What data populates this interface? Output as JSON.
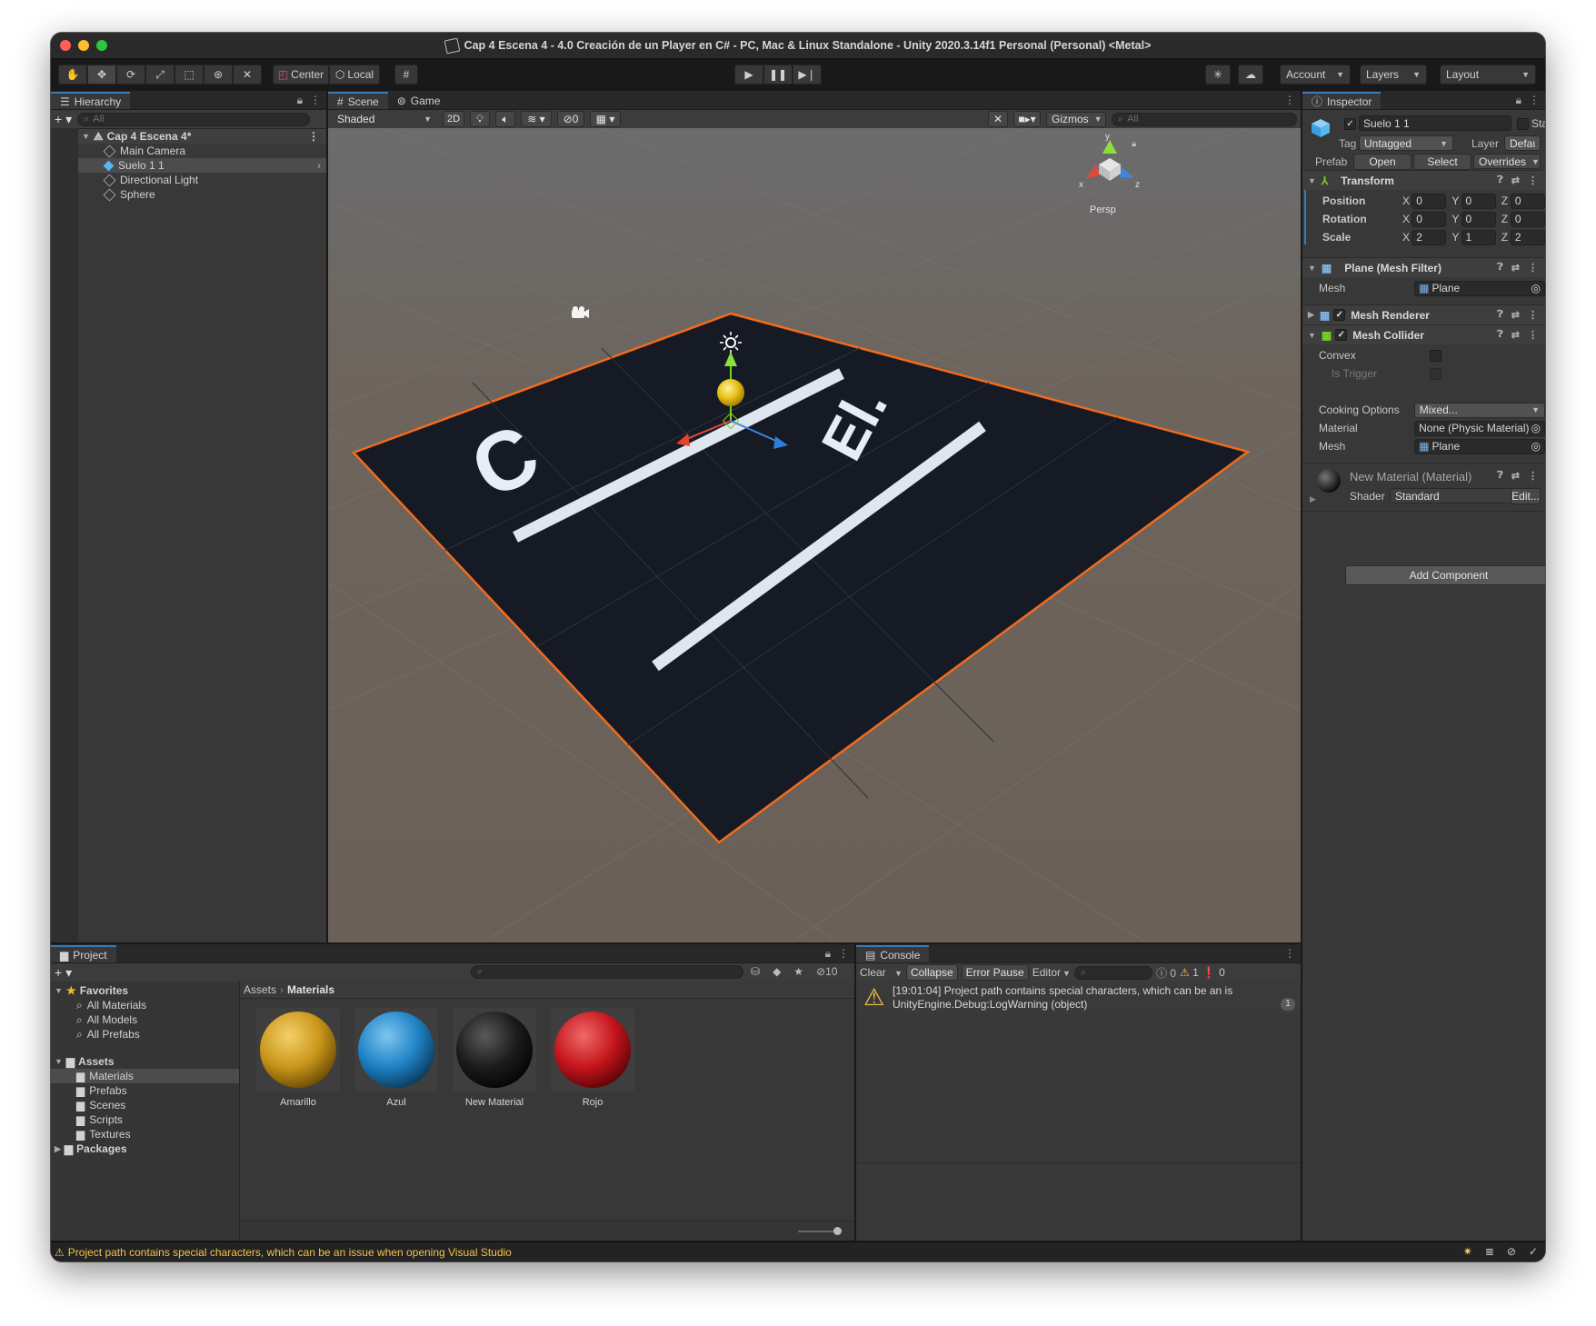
{
  "window": {
    "title": "Cap 4 Escena 4 - 4.0 Creación de un Player en C# - PC, Mac & Linux Standalone - Unity 2020.3.14f1 Personal (Personal) <Metal>"
  },
  "toolbar": {
    "pivot_label": "Center",
    "space_label": "Local",
    "account_label": "Account",
    "layers_label": "Layers",
    "layout_label": "Layout"
  },
  "hierarchy": {
    "tab": "Hierarchy",
    "search_placeholder": "All",
    "scene_name": "Cap 4 Escena 4*",
    "items": [
      {
        "label": "Main Camera"
      },
      {
        "label": "Suelo 1 1"
      },
      {
        "label": "Directional Light"
      },
      {
        "label": "Sphere"
      }
    ]
  },
  "scene": {
    "tabs": [
      "Scene",
      "Game"
    ],
    "shading_mode": "Shaded",
    "mode_2d": "2D",
    "hidden_count": "0",
    "gizmos_label": "Gizmos",
    "search_placeholder": "All",
    "gizmo_axes": {
      "x": "x",
      "y": "y",
      "z": "z"
    },
    "projection": "Persp",
    "floor_text_left": "C",
    "floor_text_right": "El."
  },
  "inspector": {
    "tab": "Inspector",
    "object_name": "Suelo 1 1",
    "static_label": "Static",
    "tag_label": "Tag",
    "tag_value": "Untagged",
    "layer_label": "Layer",
    "layer_value": "Default",
    "prefab_label": "Prefab",
    "prefab_open": "Open",
    "prefab_select": "Select",
    "prefab_overrides": "Overrides",
    "transform": {
      "title": "Transform",
      "rows": [
        {
          "label": "Position",
          "x": "0",
          "y": "0",
          "z": "0"
        },
        {
          "label": "Rotation",
          "x": "0",
          "y": "0",
          "z": "0"
        },
        {
          "label": "Scale",
          "x": "2",
          "y": "1",
          "z": "2"
        }
      ]
    },
    "mesh_filter": {
      "title": "Plane (Mesh Filter)",
      "mesh_label": "Mesh",
      "mesh_value": "Plane"
    },
    "mesh_renderer": {
      "title": "Mesh Renderer"
    },
    "mesh_collider": {
      "title": "Mesh Collider",
      "convex_label": "Convex",
      "trigger_label": "Is Trigger",
      "cooking_label": "Cooking Options",
      "cooking_value": "Mixed...",
      "material_label": "Material",
      "material_value": "None (Physic Material)",
      "mesh_label": "Mesh",
      "mesh_value": "Plane"
    },
    "material": {
      "title": "New Material (Material)",
      "shader_label": "Shader",
      "shader_value": "Standard",
      "edit_label": "Edit..."
    },
    "add_component": "Add Component"
  },
  "project": {
    "tab": "Project",
    "hidden_count": "10",
    "favorites_label": "Favorites",
    "favorites": [
      {
        "label": "All Materials"
      },
      {
        "label": "All Models"
      },
      {
        "label": "All Prefabs"
      }
    ],
    "assets_label": "Assets",
    "folders": [
      {
        "label": "Materials"
      },
      {
        "label": "Prefabs"
      },
      {
        "label": "Scenes"
      },
      {
        "label": "Scripts"
      },
      {
        "label": "Textures"
      }
    ],
    "packages_label": "Packages",
    "breadcrumb": [
      "Assets",
      "Materials"
    ],
    "items": [
      {
        "label": "Amarillo",
        "color": "#c9961a"
      },
      {
        "label": "Azul",
        "color": "#1f82c4"
      },
      {
        "label": "New Material",
        "color": "#1c1c1c"
      },
      {
        "label": "Rojo",
        "color": "#c4151b"
      }
    ]
  },
  "console": {
    "tab": "Console",
    "clear_label": "Clear",
    "collapse_label": "Collapse",
    "error_pause_label": "Error Pause",
    "editor_label": "Editor",
    "count_info": "0",
    "count_warn": "1",
    "count_error": "0",
    "message_line1": "[19:01:04] Project path contains special characters, which can be an is",
    "message_line2": "UnityEngine.Debug:LogWarning (object)",
    "message_count": "1"
  },
  "status": {
    "message": "Project path contains special characters, which can be an issue when opening Visual Studio"
  },
  "colors": {
    "accent_blue": "#3a79bb",
    "selection_orange": "#f26b1d",
    "warning_yellow": "#f1c34a"
  }
}
